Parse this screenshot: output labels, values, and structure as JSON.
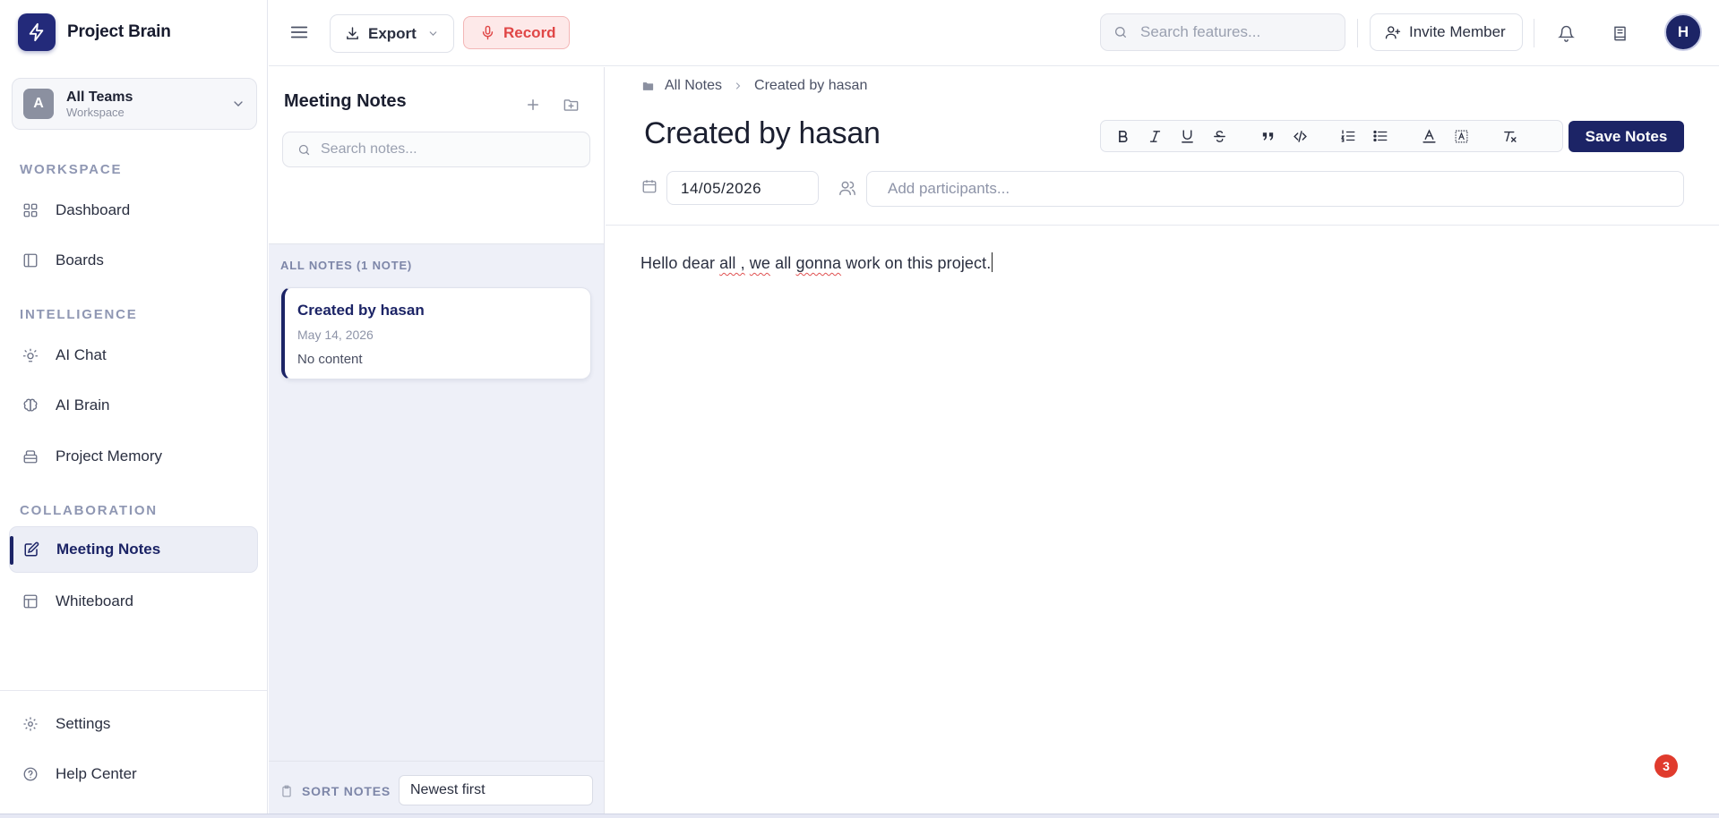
{
  "app": {
    "name": "Project Brain"
  },
  "team": {
    "initial": "A",
    "name": "All Teams",
    "subtitle": "Workspace"
  },
  "sidebar": {
    "sections": [
      {
        "label": "WORKSPACE"
      },
      {
        "label": "INTELLIGENCE"
      },
      {
        "label": "COLLABORATION"
      }
    ],
    "items": [
      {
        "label": "Dashboard",
        "icon": "grid-icon"
      },
      {
        "label": "Boards",
        "icon": "board-icon"
      },
      {
        "label": "AI Chat",
        "icon": "lightbulb-icon"
      },
      {
        "label": "AI Brain",
        "icon": "brain-icon"
      },
      {
        "label": "Project Memory",
        "icon": "archive-icon"
      },
      {
        "label": "Meeting Notes",
        "icon": "edit-icon",
        "active": true
      },
      {
        "label": "Whiteboard",
        "icon": "table-icon"
      }
    ],
    "footer": [
      {
        "label": "Settings",
        "icon": "gear-icon"
      },
      {
        "label": "Help Center",
        "icon": "help-icon"
      }
    ]
  },
  "topbar": {
    "export_label": "Export",
    "record_label": "Record",
    "search_placeholder": "Search features...",
    "invite_label": "Invite Member",
    "avatar_initial": "H"
  },
  "notes_panel": {
    "title": "Meeting Notes",
    "search_placeholder": "Search notes...",
    "list_header": "ALL NOTES (1 NOTE)",
    "notes": [
      {
        "title": "Created by hasan",
        "date": "May 14, 2026",
        "preview": "No content"
      }
    ],
    "sort_label": "SORT NOTES",
    "sort_value": "Newest first"
  },
  "editor": {
    "breadcrumb": {
      "root": "All Notes",
      "current": "Created by hasan"
    },
    "title": "Created by hasan",
    "save_label": "Save Notes",
    "date": "14/05/2026",
    "participants_placeholder": "Add participants...",
    "body": {
      "p1": "Hello dear ",
      "w1": "all ,",
      "p2": " ",
      "w2": "we",
      "p3": " all ",
      "w3": "gonna",
      "p4": " work on this project."
    }
  },
  "notifications": {
    "count": "3"
  },
  "colors": {
    "primary": "#1c2466",
    "record": "#e04646",
    "badge": "#e03b2d"
  }
}
